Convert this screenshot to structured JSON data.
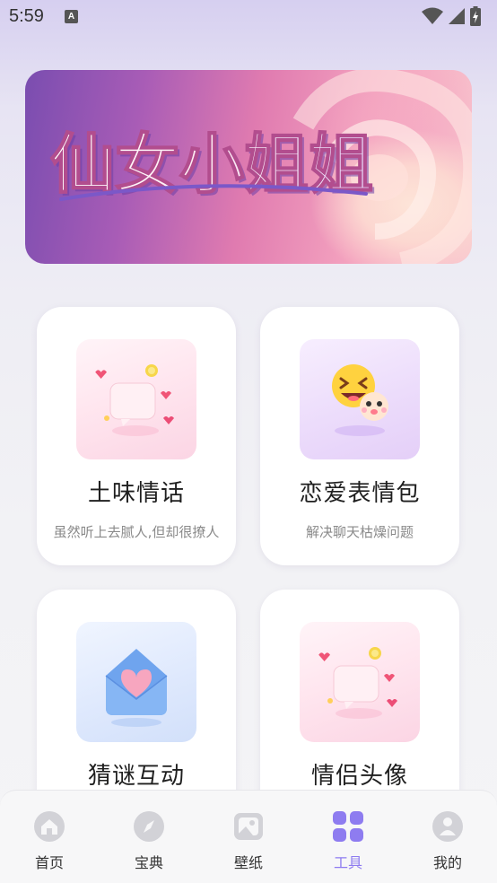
{
  "status_bar": {
    "time": "5:59",
    "notification_icon": "A",
    "icons": [
      "wifi-icon",
      "signal-icon",
      "battery-icon"
    ]
  },
  "banner": {
    "title_art_text": "仙女小姐姐"
  },
  "cards": [
    {
      "title": "土味情话",
      "subtitle": "虽然听上去腻人,但却很撩人",
      "icon": "chat-bubble-hearts-icon"
    },
    {
      "title": "恋爱表情包",
      "subtitle": "解决聊天枯燥问题",
      "icon": "emoji-faces-icon"
    },
    {
      "title": "猜谜互动",
      "subtitle": "",
      "icon": "heart-envelope-icon"
    },
    {
      "title": "情侣头像",
      "subtitle": "",
      "icon": "chat-bubble-hearts-icon"
    }
  ],
  "bottom_nav": {
    "items": [
      {
        "label": "首页",
        "icon": "home-icon"
      },
      {
        "label": "宝典",
        "icon": "compass-icon"
      },
      {
        "label": "壁纸",
        "icon": "wallpaper-icon"
      },
      {
        "label": "工具",
        "icon": "grid-icon"
      },
      {
        "label": "我的",
        "icon": "user-icon"
      }
    ],
    "active_index": 3
  },
  "colors": {
    "accent": "#8e7cf0",
    "inactive_icon": "#cfcfd4",
    "card_bg": "#ffffff"
  }
}
